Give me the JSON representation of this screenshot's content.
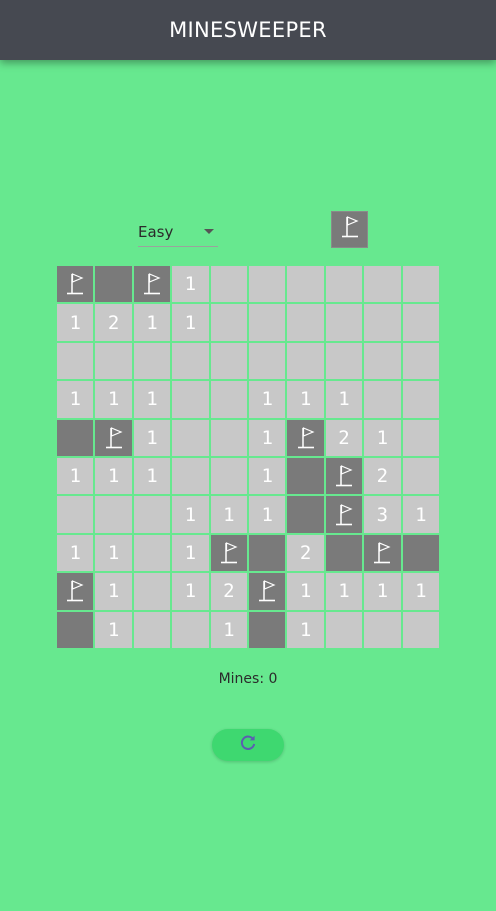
{
  "app": {
    "title": "MINESWEEPER"
  },
  "controls": {
    "difficulty": "Easy",
    "flag_mode_icon": "flag-icon"
  },
  "board": {
    "rows": [
      [
        "F",
        "D",
        "F",
        "1",
        "",
        "",
        "",
        "",
        "",
        ""
      ],
      [
        "1",
        "2",
        "1",
        "1",
        "",
        "",
        "",
        "",
        "",
        ""
      ],
      [
        "",
        "",
        "",
        "",
        "",
        "",
        "",
        "",
        "",
        ""
      ],
      [
        "1",
        "1",
        "1",
        "",
        "",
        "1",
        "1",
        "1",
        "",
        ""
      ],
      [
        "D",
        "F",
        "1",
        "",
        "",
        "1",
        "F",
        "2",
        "1",
        ""
      ],
      [
        "1",
        "1",
        "1",
        "",
        "",
        "1",
        "D",
        "F",
        "2",
        ""
      ],
      [
        "",
        "",
        "",
        "1",
        "1",
        "1",
        "D",
        "F",
        "3",
        "1"
      ],
      [
        "1",
        "1",
        "",
        "1",
        "F",
        "D",
        "2",
        "D",
        "F",
        "D"
      ],
      [
        "F",
        "1",
        "",
        "1",
        "2",
        "F",
        "1",
        "1",
        "1",
        "1"
      ],
      [
        "D",
        "1",
        "",
        "",
        "1",
        "D",
        "1",
        "",
        "",
        ""
      ]
    ],
    "legend": {
      "F": "flagged",
      "D": "dark-covered",
      "": "revealed-empty"
    }
  },
  "status": {
    "mines_text": "Mines: 0"
  },
  "reset": {
    "icon": "refresh-icon"
  },
  "colors": {
    "background": "#67e88f",
    "appbar": "#464951",
    "cell_light": "#c8c8c8",
    "cell_dark": "#7a7a7a",
    "reset_button": "#3ed870",
    "reset_icon": "#5a5fb0"
  }
}
